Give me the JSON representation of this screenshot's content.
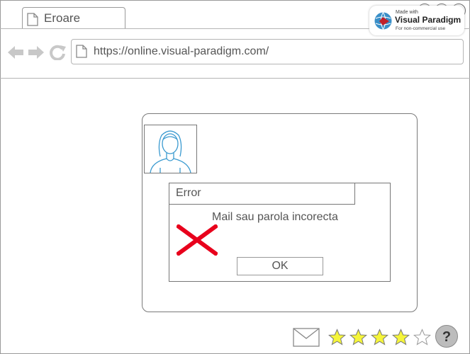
{
  "browser": {
    "tab_title": "Eroare",
    "url": "https://online.visual-paradigm.com/"
  },
  "watermark": {
    "made_with": "Made with",
    "brand": "Visual Paradigm",
    "note": "For non-commercial use"
  },
  "dialog": {
    "title": "Error",
    "message": "Mail sau parola incorecta",
    "ok_label": "OK"
  },
  "footer": {
    "rating": 4,
    "rating_max": 5,
    "help_label": "?"
  },
  "colors": {
    "error_icon": "#e8001c",
    "avatar_stroke": "#3a9ad0",
    "star_fill": "#f5f53a"
  }
}
